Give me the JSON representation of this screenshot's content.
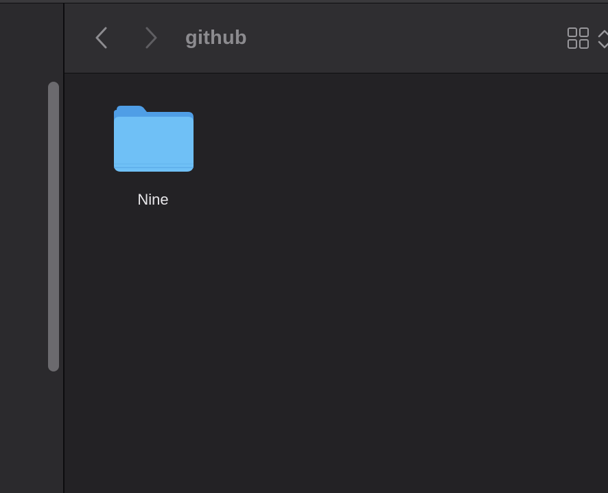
{
  "toolbar": {
    "title": "github",
    "back_icon": "chevron-left-icon",
    "forward_icon": "chevron-right-icon",
    "view_icon": "grid-view-icon",
    "view_menu_icon": "chevron-up-down-icon"
  },
  "content": {
    "items": [
      {
        "name": "Nine",
        "kind": "folder",
        "icon": "folder-icon"
      }
    ]
  },
  "colors": {
    "background": "#232225",
    "sidebar": "#2b2a2d",
    "toolbar": "#2f2e31",
    "folder_front": "#6fc0f6",
    "folder_back": "#4f9ee6"
  }
}
